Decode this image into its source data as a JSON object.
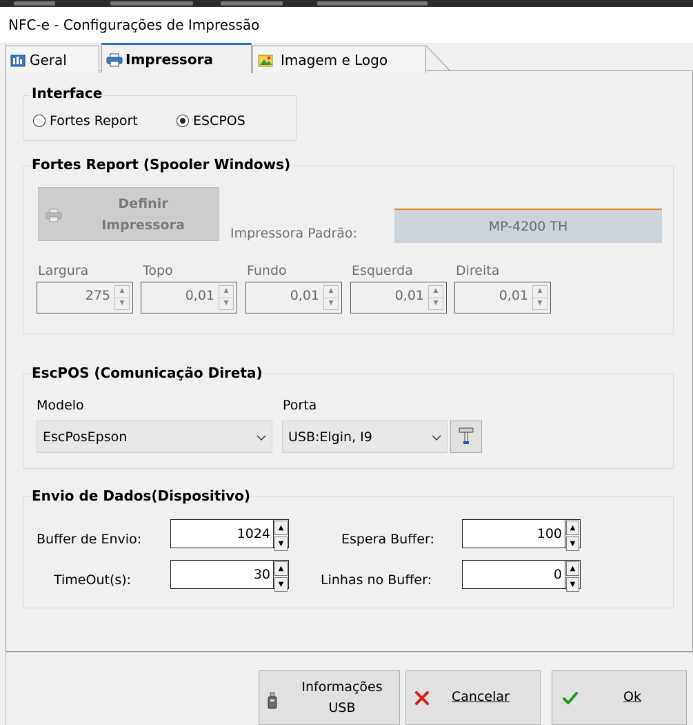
{
  "window": {
    "title": "NFC-e - Configurações de Impressão"
  },
  "tabs": [
    {
      "label": "Geral",
      "icon": "settings-panel-icon"
    },
    {
      "label": "Impressora",
      "icon": "printer-icon"
    },
    {
      "label": "Imagem e Logo",
      "icon": "image-icon"
    }
  ],
  "interface": {
    "title": "Interface",
    "options": [
      "Fortes Report",
      "ESCPOS"
    ],
    "selected": "ESCPOS"
  },
  "fortes": {
    "title": "Fortes Report (Spooler Windows)",
    "define_button": [
      "Definir",
      "Impressora"
    ],
    "default_printer_label": "Impressora Padrão:",
    "default_printer_value": "MP-4200 TH",
    "margins": [
      {
        "label": "Largura",
        "value": "275"
      },
      {
        "label": "Topo",
        "value": "0,01"
      },
      {
        "label": "Fundo",
        "value": "0,01"
      },
      {
        "label": "Esquerda",
        "value": "0,01"
      },
      {
        "label": "Direita",
        "value": "0,01"
      }
    ]
  },
  "escpos": {
    "title": "EscPOS (Comunicação Direta)",
    "modelo_label": "Modelo",
    "modelo_value": "EscPosEpson",
    "porta_label": "Porta",
    "porta_value": "USB:Elgin, I9"
  },
  "envio": {
    "title": "Envio de Dados(Dispositivo)",
    "buffer_envio_label": "Buffer de Envio:",
    "buffer_envio_value": "1024",
    "timeout_label": "TimeOut(s):",
    "timeout_value": "30",
    "espera_buffer_label": "Espera Buffer:",
    "espera_buffer_value": "100",
    "linhas_buffer_label": "Linhas no Buffer:",
    "linhas_buffer_value": "0"
  },
  "footer": {
    "usb_button": [
      "Informações",
      "USB"
    ],
    "cancel_label": "Cancelar",
    "ok_label": "Ok"
  },
  "colors": {
    "accent": "#2a6ed6",
    "cancel": "#d32020",
    "ok": "#1e9a1e",
    "underline": "#e08a2a"
  }
}
